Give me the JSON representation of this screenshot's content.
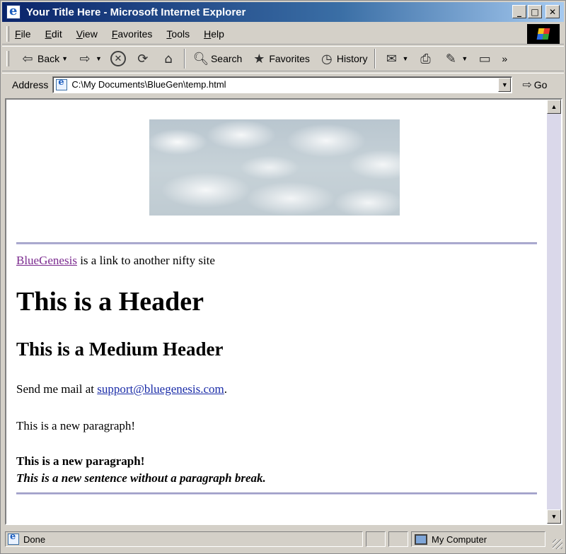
{
  "window": {
    "title": "Your Title Here - Microsoft Internet Explorer",
    "controls": {
      "minimize": "_",
      "maximize": "□",
      "close": "✕"
    }
  },
  "menu": {
    "items": [
      {
        "label": "File"
      },
      {
        "label": "Edit"
      },
      {
        "label": "View"
      },
      {
        "label": "Favorites"
      },
      {
        "label": "Tools"
      },
      {
        "label": "Help"
      }
    ]
  },
  "toolbar": {
    "back_label": "Back",
    "search_label": "Search",
    "favorites_label": "Favorites",
    "history_label": "History",
    "chevron": "»"
  },
  "address": {
    "label": "Address",
    "value": "C:\\My Documents\\BlueGen\\temp.html",
    "go_label": "Go"
  },
  "page": {
    "link_text": "BlueGenesis",
    "link_rest": " is a link to another nifty site",
    "header_large": "This is a Header",
    "header_medium": "This is a Medium Header",
    "mail_prefix": "Send me mail at ",
    "mail_address": "support@bluegenesis.com",
    "mail_suffix": ".",
    "paragraph1": "This is a new paragraph!",
    "paragraph2_bold": "This is a new paragraph!",
    "paragraph2_italic": "This is a new sentence without a paragraph break."
  },
  "status": {
    "text": "Done",
    "zone": "My Computer"
  },
  "colors": {
    "title_gradient_start": "#0a246a",
    "title_gradient_end": "#a6caf0",
    "visited_link": "#7b2a8f",
    "mail_link": "#1a2ca8",
    "rule": "#a9a8d0",
    "chrome": "#d4d0c8"
  },
  "icons": {
    "title": "ie-page-icon",
    "back": "back-arrow-icon",
    "forward": "forward-arrow-icon",
    "stop": "stop-icon",
    "refresh": "refresh-icon",
    "home": "home-icon",
    "search": "search-globe-icon",
    "favorites": "favorites-folder-icon",
    "history": "history-icon",
    "mail": "mail-icon",
    "print": "print-icon",
    "edit": "edit-icon",
    "discuss": "discuss-icon"
  }
}
